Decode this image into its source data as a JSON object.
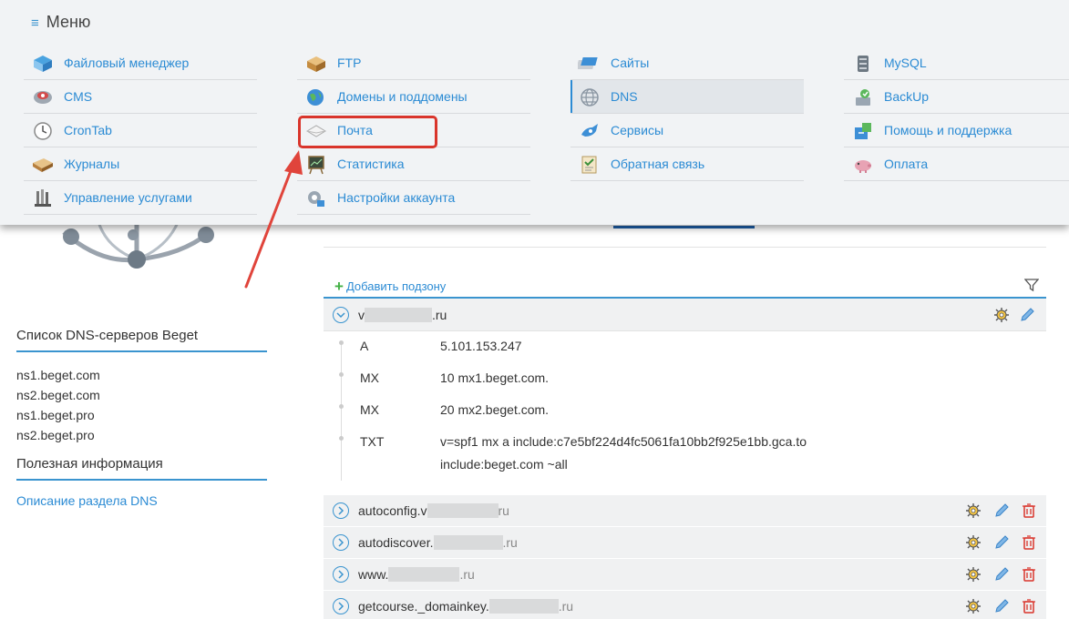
{
  "menu": {
    "title": "Меню",
    "columns": [
      [
        {
          "label": "Файловый менеджер",
          "icon": "file-manager-icon"
        },
        {
          "label": "CMS",
          "icon": "cms-icon"
        },
        {
          "label": "CronTab",
          "icon": "clock-icon"
        },
        {
          "label": "Журналы",
          "icon": "journal-icon"
        },
        {
          "label": "Управление услугами",
          "icon": "services-management-icon"
        }
      ],
      [
        {
          "label": "FTP",
          "icon": "ftp-icon"
        },
        {
          "label": "Домены и поддомены",
          "icon": "domains-icon"
        },
        {
          "label": "Почта",
          "icon": "mail-icon"
        },
        {
          "label": "Статистика",
          "icon": "statistics-icon"
        },
        {
          "label": "Настройки аккаунта",
          "icon": "account-settings-icon"
        }
      ],
      [
        {
          "label": "Сайты",
          "icon": "sites-icon"
        },
        {
          "label": "DNS",
          "icon": "dns-icon",
          "active": true
        },
        {
          "label": "Сервисы",
          "icon": "services-icon"
        },
        {
          "label": "Обратная связь",
          "icon": "feedback-icon"
        }
      ],
      [
        {
          "label": "MySQL",
          "icon": "mysql-icon"
        },
        {
          "label": "BackUp",
          "icon": "backup-icon"
        },
        {
          "label": "Помощь и поддержка",
          "icon": "help-icon"
        },
        {
          "label": "Оплата",
          "icon": "payment-icon"
        }
      ]
    ]
  },
  "sidebar": {
    "dns_servers_title": "Список DNS-серверов Beget",
    "dns_servers": [
      "ns1.beget.com",
      "ns2.beget.com",
      "ns1.beget.pro",
      "ns2.beget.pro"
    ],
    "info_title": "Полезная информация",
    "info_link": "Описание раздела DNS"
  },
  "zone": {
    "add_subzone": "Добавить подзону",
    "domain_prefix": "v",
    "domain_suffix": ".ru",
    "records": [
      {
        "type": "A",
        "value": "5.101.153.247"
      },
      {
        "type": "MX",
        "value": "10 mx1.beget.com."
      },
      {
        "type": "MX",
        "value": "20 mx2.beget.com."
      },
      {
        "type": "TXT",
        "value": "v=spf1 mx a include:c7e5bf224d4fc5061fa10bb2f925e1bb.gca.to include:beget.com ~all"
      }
    ],
    "subzones": [
      {
        "prefix": "autoconfig.v",
        "suffix": "ru"
      },
      {
        "prefix": "autodiscover.",
        "suffix": ".ru"
      },
      {
        "prefix": "www.",
        "suffix": ".ru"
      },
      {
        "prefix": "getcourse._domainkey.",
        "suffix": ".ru"
      }
    ]
  },
  "colors": {
    "accent": "#2b8bd4",
    "highlight": "#d9342b",
    "menu_bg": "#f1f3f5"
  }
}
